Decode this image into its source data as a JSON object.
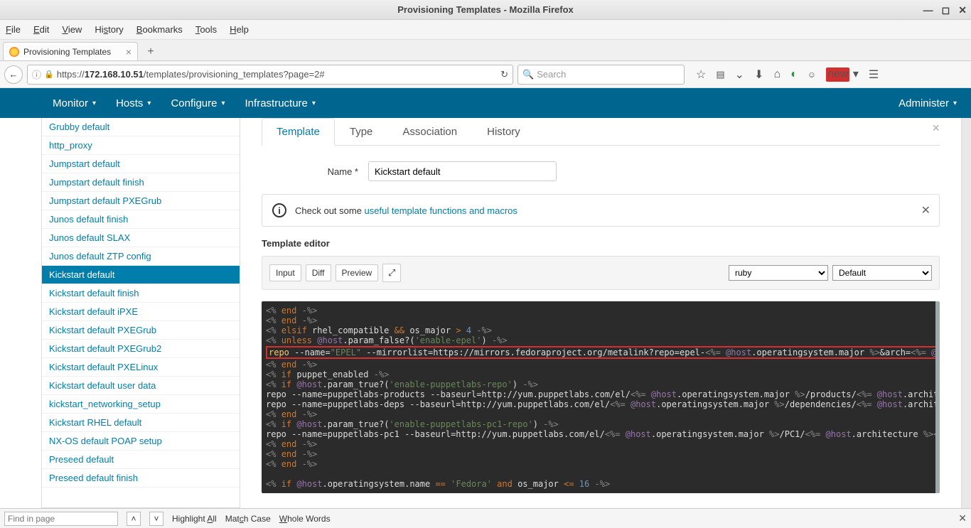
{
  "window": {
    "title": "Provisioning Templates - Mozilla Firefox"
  },
  "menubar": {
    "file": "File",
    "edit": "Edit",
    "view": "View",
    "history": "History",
    "bookmarks": "Bookmarks",
    "tools": "Tools",
    "help": "Help"
  },
  "tab": {
    "title": "Provisioning Templates"
  },
  "url": {
    "host": "172.168.10.51",
    "path": "/templates/provisioning_templates?page=2#",
    "prefix": "https://"
  },
  "search": {
    "placeholder": "Search"
  },
  "topnav": {
    "monitor": "Monitor",
    "hosts": "Hosts",
    "configure": "Configure",
    "infrastructure": "Infrastructure",
    "administer": "Administer"
  },
  "sidebar": {
    "items": [
      "Grubby default",
      "http_proxy",
      "Jumpstart default",
      "Jumpstart default finish",
      "Jumpstart default PXEGrub",
      "Junos default finish",
      "Junos default SLAX",
      "Junos default ZTP config",
      "Kickstart default",
      "Kickstart default finish",
      "Kickstart default iPXE",
      "Kickstart default PXEGrub",
      "Kickstart default PXEGrub2",
      "Kickstart default PXELinux",
      "Kickstart default user data",
      "kickstart_networking_setup",
      "Kickstart RHEL default",
      "NX-OS default POAP setup",
      "Preseed default",
      "Preseed default finish"
    ],
    "active_index": 8
  },
  "tabs": {
    "template": "Template",
    "type": "Type",
    "association": "Association",
    "history": "History"
  },
  "form": {
    "name_label": "Name *",
    "name_value": "Kickstart default"
  },
  "alert": {
    "text": "Check out some ",
    "link": "useful template functions and macros"
  },
  "editor_label": "Template editor",
  "editor_toolbar": {
    "input": "Input",
    "diff": "Diff",
    "preview": "Preview",
    "lang": "ruby",
    "theme": "Default"
  },
  "findbar": {
    "placeholder": "Find in page",
    "highlight": "Highlight All",
    "match": "Match Case",
    "whole": "Whole Words"
  }
}
